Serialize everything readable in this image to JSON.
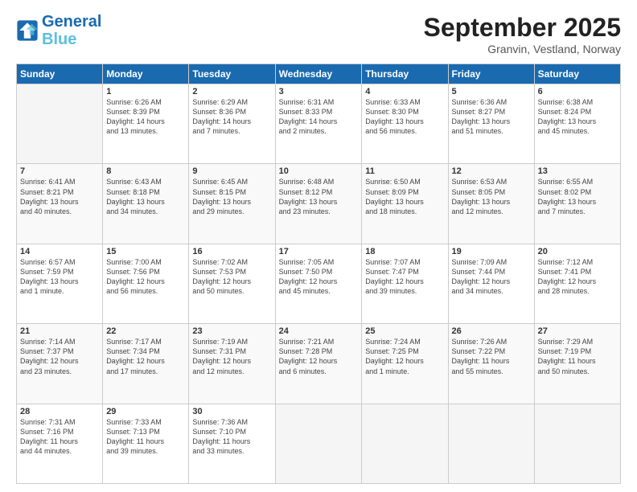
{
  "logo": {
    "line1": "General",
    "line2": "Blue"
  },
  "title": "September 2025",
  "location": "Granvin, Vestland, Norway",
  "days_header": [
    "Sunday",
    "Monday",
    "Tuesday",
    "Wednesday",
    "Thursday",
    "Friday",
    "Saturday"
  ],
  "weeks": [
    [
      {
        "num": "",
        "info": ""
      },
      {
        "num": "1",
        "info": "Sunrise: 6:26 AM\nSunset: 8:39 PM\nDaylight: 14 hours\nand 13 minutes."
      },
      {
        "num": "2",
        "info": "Sunrise: 6:29 AM\nSunset: 8:36 PM\nDaylight: 14 hours\nand 7 minutes."
      },
      {
        "num": "3",
        "info": "Sunrise: 6:31 AM\nSunset: 8:33 PM\nDaylight: 14 hours\nand 2 minutes."
      },
      {
        "num": "4",
        "info": "Sunrise: 6:33 AM\nSunset: 8:30 PM\nDaylight: 13 hours\nand 56 minutes."
      },
      {
        "num": "5",
        "info": "Sunrise: 6:36 AM\nSunset: 8:27 PM\nDaylight: 13 hours\nand 51 minutes."
      },
      {
        "num": "6",
        "info": "Sunrise: 6:38 AM\nSunset: 8:24 PM\nDaylight: 13 hours\nand 45 minutes."
      }
    ],
    [
      {
        "num": "7",
        "info": "Sunrise: 6:41 AM\nSunset: 8:21 PM\nDaylight: 13 hours\nand 40 minutes."
      },
      {
        "num": "8",
        "info": "Sunrise: 6:43 AM\nSunset: 8:18 PM\nDaylight: 13 hours\nand 34 minutes."
      },
      {
        "num": "9",
        "info": "Sunrise: 6:45 AM\nSunset: 8:15 PM\nDaylight: 13 hours\nand 29 minutes."
      },
      {
        "num": "10",
        "info": "Sunrise: 6:48 AM\nSunset: 8:12 PM\nDaylight: 13 hours\nand 23 minutes."
      },
      {
        "num": "11",
        "info": "Sunrise: 6:50 AM\nSunset: 8:09 PM\nDaylight: 13 hours\nand 18 minutes."
      },
      {
        "num": "12",
        "info": "Sunrise: 6:53 AM\nSunset: 8:05 PM\nDaylight: 13 hours\nand 12 minutes."
      },
      {
        "num": "13",
        "info": "Sunrise: 6:55 AM\nSunset: 8:02 PM\nDaylight: 13 hours\nand 7 minutes."
      }
    ],
    [
      {
        "num": "14",
        "info": "Sunrise: 6:57 AM\nSunset: 7:59 PM\nDaylight: 13 hours\nand 1 minute."
      },
      {
        "num": "15",
        "info": "Sunrise: 7:00 AM\nSunset: 7:56 PM\nDaylight: 12 hours\nand 56 minutes."
      },
      {
        "num": "16",
        "info": "Sunrise: 7:02 AM\nSunset: 7:53 PM\nDaylight: 12 hours\nand 50 minutes."
      },
      {
        "num": "17",
        "info": "Sunrise: 7:05 AM\nSunset: 7:50 PM\nDaylight: 12 hours\nand 45 minutes."
      },
      {
        "num": "18",
        "info": "Sunrise: 7:07 AM\nSunset: 7:47 PM\nDaylight: 12 hours\nand 39 minutes."
      },
      {
        "num": "19",
        "info": "Sunrise: 7:09 AM\nSunset: 7:44 PM\nDaylight: 12 hours\nand 34 minutes."
      },
      {
        "num": "20",
        "info": "Sunrise: 7:12 AM\nSunset: 7:41 PM\nDaylight: 12 hours\nand 28 minutes."
      }
    ],
    [
      {
        "num": "21",
        "info": "Sunrise: 7:14 AM\nSunset: 7:37 PM\nDaylight: 12 hours\nand 23 minutes."
      },
      {
        "num": "22",
        "info": "Sunrise: 7:17 AM\nSunset: 7:34 PM\nDaylight: 12 hours\nand 17 minutes."
      },
      {
        "num": "23",
        "info": "Sunrise: 7:19 AM\nSunset: 7:31 PM\nDaylight: 12 hours\nand 12 minutes."
      },
      {
        "num": "24",
        "info": "Sunrise: 7:21 AM\nSunset: 7:28 PM\nDaylight: 12 hours\nand 6 minutes."
      },
      {
        "num": "25",
        "info": "Sunrise: 7:24 AM\nSunset: 7:25 PM\nDaylight: 12 hours\nand 1 minute."
      },
      {
        "num": "26",
        "info": "Sunrise: 7:26 AM\nSunset: 7:22 PM\nDaylight: 11 hours\nand 55 minutes."
      },
      {
        "num": "27",
        "info": "Sunrise: 7:29 AM\nSunset: 7:19 PM\nDaylight: 11 hours\nand 50 minutes."
      }
    ],
    [
      {
        "num": "28",
        "info": "Sunrise: 7:31 AM\nSunset: 7:16 PM\nDaylight: 11 hours\nand 44 minutes."
      },
      {
        "num": "29",
        "info": "Sunrise: 7:33 AM\nSunset: 7:13 PM\nDaylight: 11 hours\nand 39 minutes."
      },
      {
        "num": "30",
        "info": "Sunrise: 7:36 AM\nSunset: 7:10 PM\nDaylight: 11 hours\nand 33 minutes."
      },
      {
        "num": "",
        "info": ""
      },
      {
        "num": "",
        "info": ""
      },
      {
        "num": "",
        "info": ""
      },
      {
        "num": "",
        "info": ""
      }
    ]
  ]
}
